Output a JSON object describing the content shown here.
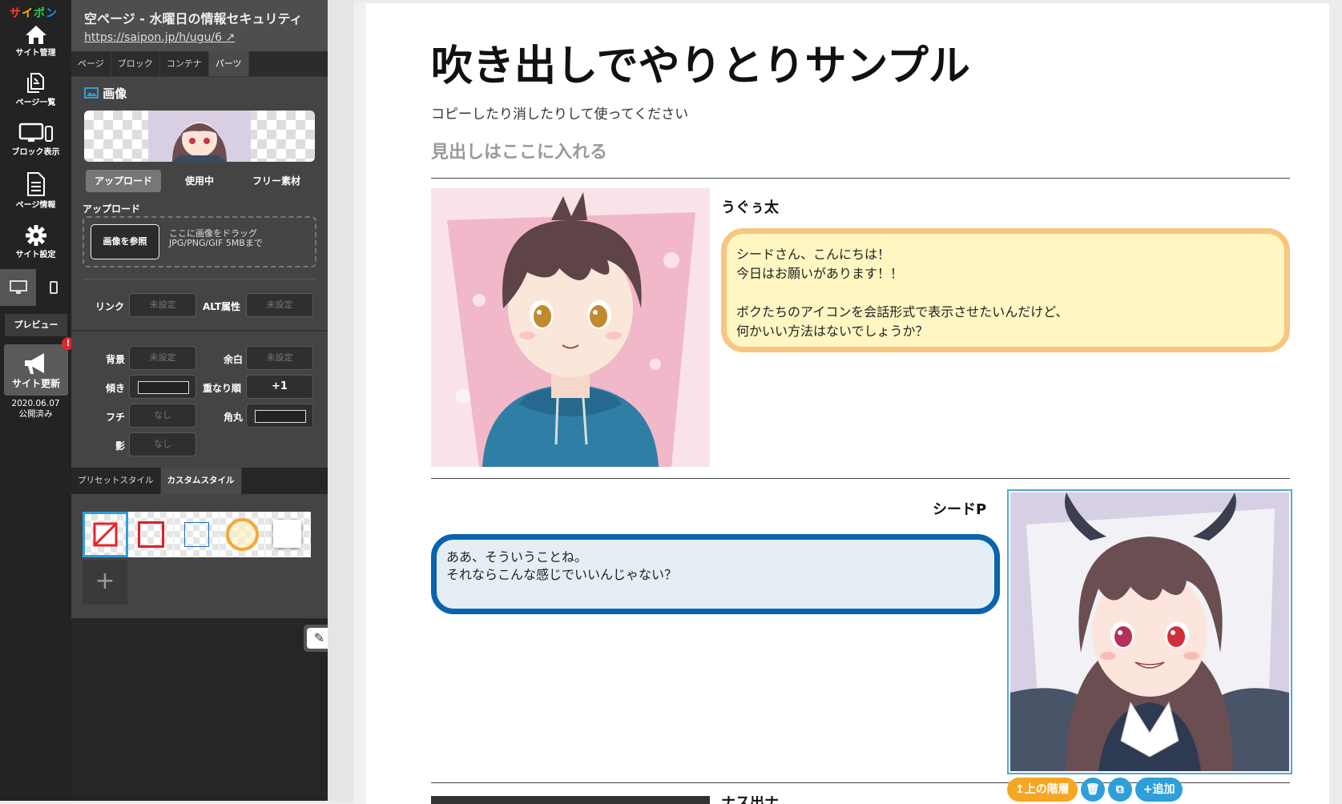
{
  "app": {
    "logo": "サイポン",
    "logo_colors": [
      "#ff3b3b",
      "#ffb400",
      "#2ecc40",
      "#1e90ff",
      "#ff3b3b"
    ]
  },
  "rail": {
    "items": [
      {
        "label": "サイト管理",
        "icon": "home-icon"
      },
      {
        "label": "ページ一覧",
        "icon": "pages-icon"
      },
      {
        "label": "ブロック表示",
        "icon": "devices-icon"
      },
      {
        "label": "ページ情報",
        "icon": "document-icon"
      },
      {
        "label": "サイト設定",
        "icon": "gear-icon"
      }
    ],
    "preview_label": "プレビュー",
    "update_label": "サイト更新",
    "update_badge": "!",
    "published_date": "2020.06.07",
    "published_label": "公開済み"
  },
  "panel": {
    "title": "空ページ - 水曜日の情報セキュリティ",
    "url": "https://saipon.jp/h/ugu/6",
    "tabs": [
      {
        "label": "ページ",
        "active": false
      },
      {
        "label": "ブロック",
        "active": false
      },
      {
        "label": "コンテナ",
        "active": false
      },
      {
        "label": "パーツ",
        "active": true
      }
    ],
    "section_title": "画像",
    "source_tabs": [
      {
        "label": "アップロード",
        "active": true
      },
      {
        "label": "使用中",
        "active": false
      },
      {
        "label": "フリー素材",
        "active": false
      }
    ],
    "upload_label": "アップロード",
    "browse_button": "画像を参照",
    "drop_hint_1": "ここに画像をドラッグ",
    "drop_hint_2": "JPG/PNG/GIF 5MBまで",
    "fields": {
      "link_label": "リンク",
      "link_value": "未設定",
      "alt_label": "ALT属性",
      "alt_value": "未設定",
      "bg_label": "背景",
      "bg_value": "未設定",
      "margin_label": "余白",
      "margin_value": "未設定",
      "tilt_label": "傾き",
      "zorder_label": "重なり順",
      "zorder_value": "+1",
      "border_label": "フチ",
      "border_value": "なし",
      "radius_label": "角丸",
      "shadow_label": "影",
      "shadow_value": "なし"
    },
    "style_tabs": [
      {
        "label": "プリセットスタイル",
        "active": false
      },
      {
        "label": "カスタムスタイル",
        "active": true
      }
    ],
    "add_style": "+",
    "edit_button": "編集"
  },
  "page": {
    "title": "吹き出しでやりとりサンプル",
    "subtitle": "コピーしたり消したりして使ってください",
    "heading": "見出しはここに入れる",
    "messages": [
      {
        "name": "うぐぅ太",
        "text": "シードさん、こんにちは！\n今日はお願いがあります！！\n\nボクたちのアイコンを会話形式で表示させたいんだけど、\n何かいい方法はないでしょうか？"
      },
      {
        "name": "シードP",
        "text": "ああ、そういうことね。\nそれならこんな感じでいいんじゃない？"
      }
    ],
    "next_name": "ナス出ナ"
  },
  "toolbar": {
    "up_label": "上の階層",
    "add_label": "追加"
  },
  "colors": {
    "accent": "#2e9fd8",
    "bubble1_border": "#f8c680",
    "bubble1_fill": "#fff6c2",
    "bubble2_border": "#0a63ae",
    "bubble2_fill": "#e5eef5",
    "up_button": "#f5a623"
  }
}
